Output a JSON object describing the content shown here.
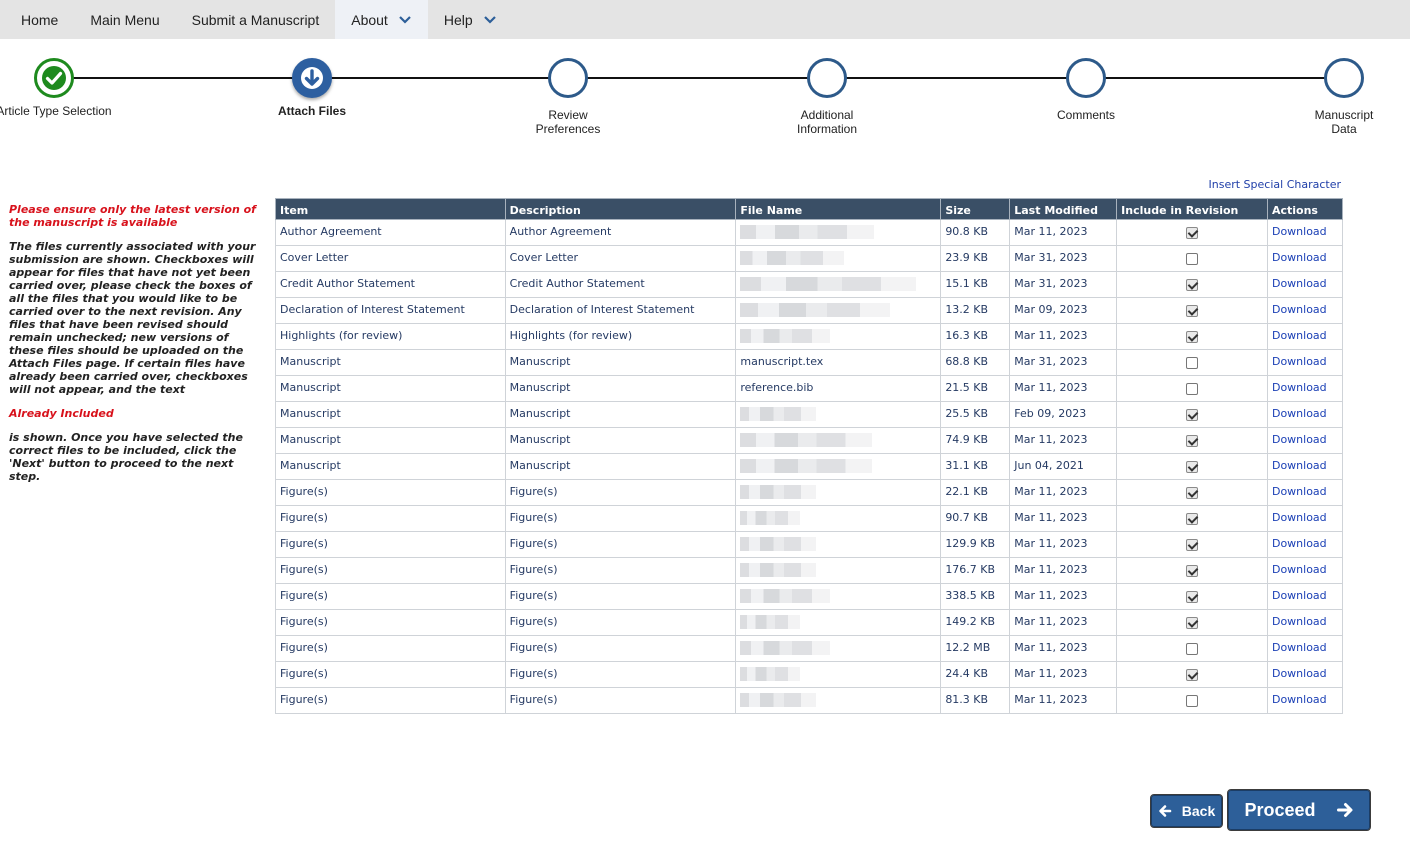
{
  "nav": {
    "items": [
      {
        "label": "Home",
        "dropdown": false
      },
      {
        "label": "Main Menu",
        "dropdown": false
      },
      {
        "label": "Submit a Manuscript",
        "dropdown": false
      },
      {
        "label": "About",
        "dropdown": true
      },
      {
        "label": "Help",
        "dropdown": true
      }
    ]
  },
  "steps": [
    {
      "label": "Article Type Selection",
      "state": "complete",
      "icon": "check-icon"
    },
    {
      "label": "Attach Files",
      "state": "current",
      "icon": "down-arrow-icon"
    },
    {
      "label": "Review Preferences",
      "state": "pending"
    },
    {
      "label": "Additional Information",
      "state": "pending"
    },
    {
      "label": "Comments",
      "state": "pending"
    },
    {
      "label": "Manuscript Data",
      "state": "pending"
    }
  ],
  "info": {
    "warning": "Please ensure only the latest version of the manuscript is available",
    "body1": "The files currently associated with your submission are shown. Checkboxes will appear for files that have not yet been carried over, please check the boxes of all the files that you would like to be carried over to the next revision. Any files that have been revised should remain unchecked; new versions of these files should be uploaded on the Attach Files page. If certain files have already been carried over, checkboxes will not appear, and the text",
    "already": "Already Included",
    "body2": "is shown. Once you have selected the correct files to be included, click the 'Next' button to proceed to the next step."
  },
  "special_char_link": "Insert Special Character",
  "table": {
    "headers": [
      "Item",
      "Description",
      "File Name",
      "Size",
      "Last Modified",
      "Include in Revision",
      "Actions"
    ],
    "action_label": "Download",
    "rows": [
      {
        "item": "Author Agreement",
        "description": "Author Agreement",
        "file_name": "",
        "size": "90.8 KB",
        "modified": "Mar 11, 2023",
        "include": true
      },
      {
        "item": "Cover Letter",
        "description": "Cover Letter",
        "file_name": "",
        "size": "23.9 KB",
        "modified": "Mar 31, 2023",
        "include": false
      },
      {
        "item": "Credit Author Statement",
        "description": "Credit Author Statement",
        "file_name": "",
        "size": "15.1 KB",
        "modified": "Mar 31, 2023",
        "include": true
      },
      {
        "item": "Declaration of Interest Statement",
        "description": "Declaration of Interest Statement",
        "file_name": "",
        "size": "13.2 KB",
        "modified": "Mar 09, 2023",
        "include": true
      },
      {
        "item": "Highlights (for review)",
        "description": "Highlights (for review)",
        "file_name": "",
        "size": "16.3 KB",
        "modified": "Mar 11, 2023",
        "include": true
      },
      {
        "item": "Manuscript",
        "description": "Manuscript",
        "file_name": "manuscript.tex",
        "size": "68.8 KB",
        "modified": "Mar 31, 2023",
        "include": false
      },
      {
        "item": "Manuscript",
        "description": "Manuscript",
        "file_name": "reference.bib",
        "size": "21.5 KB",
        "modified": "Mar 11, 2023",
        "include": false
      },
      {
        "item": "Manuscript",
        "description": "Manuscript",
        "file_name": "",
        "size": "25.5 KB",
        "modified": "Feb 09, 2023",
        "include": true
      },
      {
        "item": "Manuscript",
        "description": "Manuscript",
        "file_name": "",
        "size": "74.9 KB",
        "modified": "Mar 11, 2023",
        "include": true
      },
      {
        "item": "Manuscript",
        "description": "Manuscript",
        "file_name": "",
        "size": "31.1 KB",
        "modified": "Jun 04, 2021",
        "include": true
      },
      {
        "item": "Figure(s)",
        "description": "Figure(s)",
        "file_name": "",
        "size": "22.1 KB",
        "modified": "Mar 11, 2023",
        "include": true
      },
      {
        "item": "Figure(s)",
        "description": "Figure(s)",
        "file_name": "",
        "size": "90.7 KB",
        "modified": "Mar 11, 2023",
        "include": true
      },
      {
        "item": "Figure(s)",
        "description": "Figure(s)",
        "file_name": "",
        "size": "129.9 KB",
        "modified": "Mar 11, 2023",
        "include": true
      },
      {
        "item": "Figure(s)",
        "description": "Figure(s)",
        "file_name": "",
        "size": "176.7 KB",
        "modified": "Mar 11, 2023",
        "include": true
      },
      {
        "item": "Figure(s)",
        "description": "Figure(s)",
        "file_name": "",
        "size": "338.5 KB",
        "modified": "Mar 11, 2023",
        "include": true
      },
      {
        "item": "Figure(s)",
        "description": "Figure(s)",
        "file_name": "",
        "size": "149.2 KB",
        "modified": "Mar 11, 2023",
        "include": true
      },
      {
        "item": "Figure(s)",
        "description": "Figure(s)",
        "file_name": "",
        "size": "12.2 MB",
        "modified": "Mar 11, 2023",
        "include": false
      },
      {
        "item": "Figure(s)",
        "description": "Figure(s)",
        "file_name": "",
        "size": "24.4 KB",
        "modified": "Mar 11, 2023",
        "include": true
      },
      {
        "item": "Figure(s)",
        "description": "Figure(s)",
        "file_name": "",
        "size": "81.3 KB",
        "modified": "Mar 11, 2023",
        "include": false
      }
    ]
  },
  "buttons": {
    "back": "Back",
    "proceed": "Proceed"
  },
  "colors": {
    "accent": "#2d5f99",
    "header_bg": "#3a4f66",
    "complete": "#1e8a1e",
    "warning": "#d8121c",
    "link": "#1a3fb5"
  }
}
